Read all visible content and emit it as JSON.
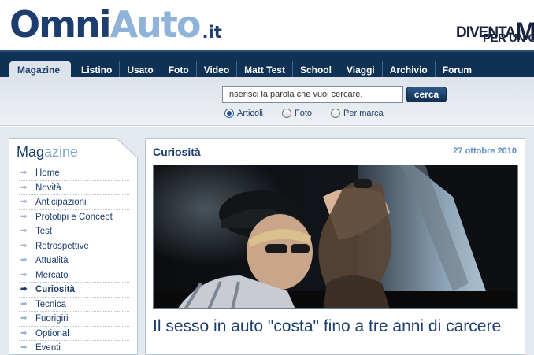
{
  "brand": {
    "omni": "Omni",
    "auto": "Auto",
    "tld": ".it"
  },
  "banner": {
    "line1": "DIVENTA",
    "line1_big": "MA",
    "line2": "PER UN GIO"
  },
  "nav": {
    "tabs": [
      "Magazine",
      "Listino",
      "Usato",
      "Foto",
      "Video",
      "Matt Test",
      "School",
      "Viaggi",
      "Archivio",
      "Forum"
    ],
    "active": "Magazine"
  },
  "search": {
    "value": "Inserisci la parola che vuoi cercare.",
    "button_label": "cerca",
    "options": [
      "Articoli",
      "Foto",
      "Per marca"
    ],
    "selected": "Articoli"
  },
  "sidebar": {
    "title_a": "Mag",
    "title_b": "azine",
    "items": [
      "Home",
      "Novità",
      "Anticipazioni",
      "Prototipi e Concept",
      "Test",
      "Retrospettive",
      "Attualità",
      "Mercato",
      "Curiosità",
      "Tecnica",
      "Fuorigiri",
      "Optional",
      "Eventi"
    ],
    "active": "Curiosità"
  },
  "article": {
    "category": "Curiosità",
    "date": "27 ottobre 2010",
    "title": "Il sesso in auto \"costa\" fino a tre anni di carcere"
  },
  "colors": {
    "navy": "#1c3d6e",
    "light_blue": "#8fb3d9",
    "nav_bg": "#0f3254",
    "date_blue": "#5b8fc9"
  }
}
